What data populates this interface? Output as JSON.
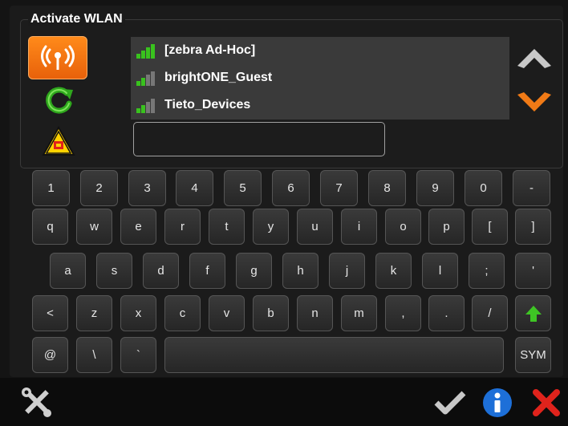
{
  "dialog": {
    "title": "Activate WLAN"
  },
  "networks": [
    {
      "name": "[zebra Ad-Hoc]",
      "signal": 4
    },
    {
      "name": "brightONE_Guest",
      "signal": 2
    },
    {
      "name": "Tieto_Devices",
      "signal": 2
    }
  ],
  "password_value": "",
  "keyboard": {
    "row1": [
      "1",
      "2",
      "3",
      "4",
      "5",
      "6",
      "7",
      "8",
      "9",
      "0",
      "-"
    ],
    "row2": [
      "q",
      "w",
      "e",
      "r",
      "t",
      "y",
      "u",
      "i",
      "o",
      "p",
      "[",
      "]"
    ],
    "row3": [
      "a",
      "s",
      "d",
      "f",
      "g",
      "h",
      "j",
      "k",
      "l",
      ";",
      "'"
    ],
    "row4": [
      "<",
      "z",
      "x",
      "c",
      "v",
      "b",
      "n",
      "m",
      ",",
      ".",
      "/"
    ],
    "row5": [
      "@",
      "\\",
      "`",
      "",
      "SYM"
    ]
  },
  "colors": {
    "accent": "#f07a16",
    "signal_green": "#39c21e",
    "confirm_red": "#e0231c",
    "info_blue": "#1d6fd8"
  },
  "icons": {
    "wifi": "wifi-antenna-icon",
    "refresh": "refresh-icon",
    "warning": "warning-icon",
    "scroll_up": "chevron-up-icon",
    "scroll_down": "chevron-down-icon",
    "shift": "shift-up-arrow-icon",
    "settings": "tools-icon",
    "ok": "checkmark-icon",
    "info": "info-icon",
    "cancel": "close-icon"
  }
}
